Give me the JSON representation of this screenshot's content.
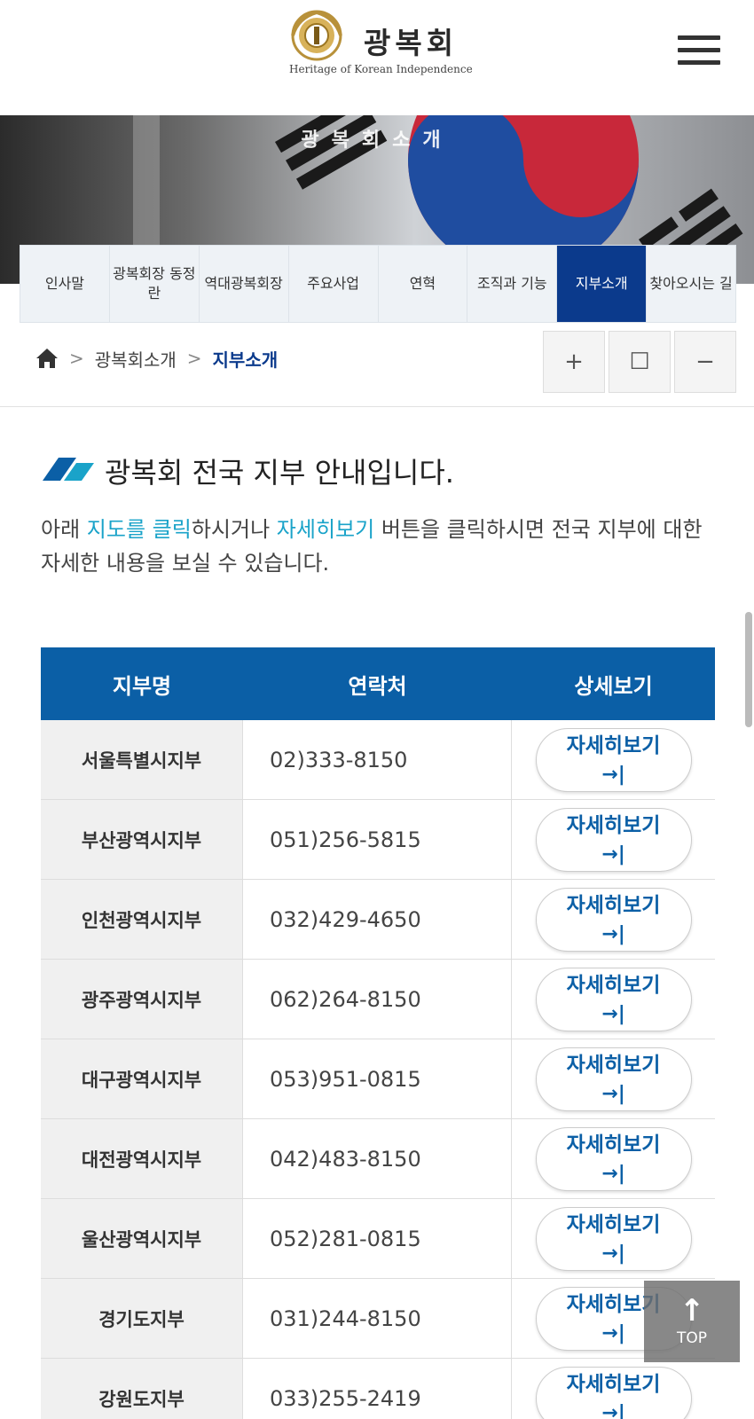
{
  "header": {
    "logo_title": "광복회",
    "logo_subtitle": "Heritage of Korean Independence",
    "menu_icon": "hamburger-menu-icon"
  },
  "banner": {
    "title": "광복회소개"
  },
  "subnav": {
    "items": [
      {
        "label": "인사말"
      },
      {
        "label": "광복회장 동정란"
      },
      {
        "label": "역대광복회장"
      },
      {
        "label": "주요사업"
      },
      {
        "label": "연혁"
      },
      {
        "label": "조직과 기능"
      },
      {
        "label": "지부소개",
        "active": true
      },
      {
        "label": "찾아오시는 길"
      }
    ]
  },
  "breadcrumb": {
    "home_icon": "home-icon",
    "items": [
      "광복회소개",
      "지부소개"
    ]
  },
  "zoom": {
    "plus": "+",
    "reset": "☐",
    "minus": "−"
  },
  "section": {
    "title": "광복회 전국 지부 안내입니다.",
    "desc_part1": "아래 ",
    "desc_hl1": "지도를 클릭",
    "desc_part2": "하시거나 ",
    "desc_hl2": "자세히보기",
    "desc_part3": " 버튼을 클릭하시면 전국 지부에 대한 자세한 내용을 보실 수 있습니다."
  },
  "table": {
    "headers": [
      "지부명",
      "연락처",
      "상세보기"
    ],
    "detail_label": "자세히보기",
    "detail_arrow": "→|",
    "rows": [
      {
        "name": "서울특별시지부",
        "phone": "02)333-8150"
      },
      {
        "name": "부산광역시지부",
        "phone": "051)256-5815"
      },
      {
        "name": "인천광역시지부",
        "phone": "032)429-4650"
      },
      {
        "name": "광주광역시지부",
        "phone": "062)264-8150"
      },
      {
        "name": "대구광역시지부",
        "phone": "053)951-0815"
      },
      {
        "name": "대전광역시지부",
        "phone": "042)483-8150"
      },
      {
        "name": "울산광역시지부",
        "phone": "052)281-0815"
      },
      {
        "name": "경기도지부",
        "phone": "031)244-8150"
      },
      {
        "name": "강원도지부",
        "phone": "033)255-2419"
      }
    ]
  },
  "top_button": {
    "arrow": "↑",
    "label": "TOP"
  },
  "colors": {
    "primary_navy": "#0b3a8c",
    "table_header": "#0b5fa6",
    "highlight": "#1aa3c9"
  }
}
